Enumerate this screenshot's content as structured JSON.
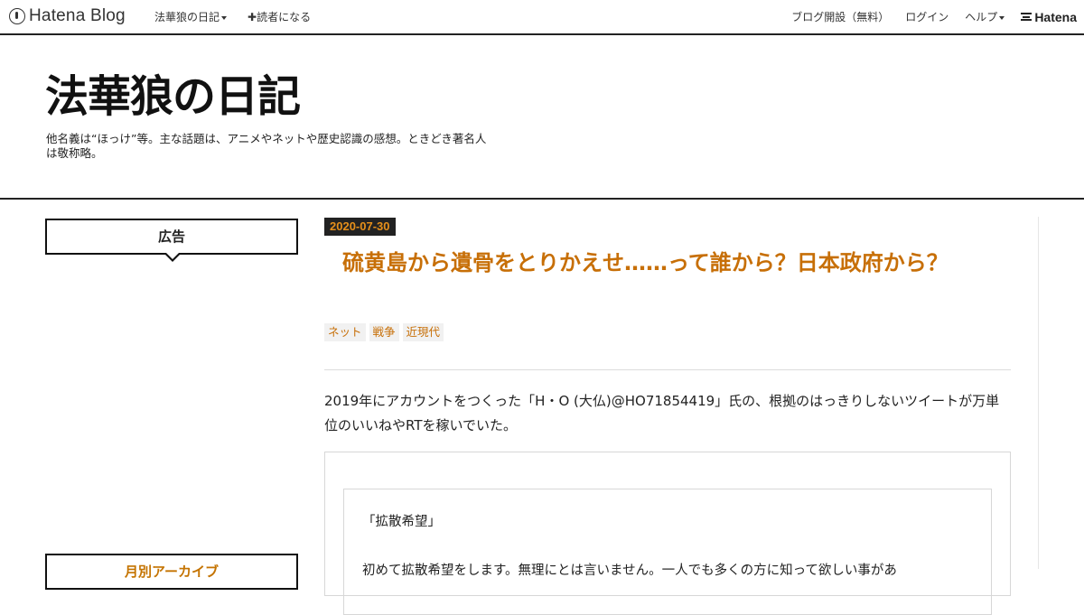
{
  "navbar": {
    "brand": "Hatena Blog",
    "blog_menu": "法華狼の日記",
    "subscribe": "✚読者になる",
    "open_blog": "ブログ開設（無料）",
    "login": "ログイン",
    "help": "ヘルプ",
    "hatena_logo": "Hatena"
  },
  "header": {
    "title": "法華狼の日記",
    "description": "他名義は“ほっけ”等。主な話題は、アニメやネットや歴史認識の感想。ときどき著名人は敬称略。"
  },
  "sidebar": {
    "ad_label": "広告",
    "archive_label": "月別アーカイブ"
  },
  "entry": {
    "date": "2020-07-30",
    "title": "硫黄島から遺骨をとりかえせ……って誰から？日本政府から？",
    "tags": [
      "ネット",
      "戦争",
      "近現代"
    ],
    "body": "2019年にアカウントをつくった「H・O (大仏)@HO71854419」氏の、根拠のはっきりしないツイートが万単位のいいねやRTを稼いでいた。",
    "embed_quote_title": "「拡散希望」",
    "embed_quote_text": "初めて拡散希望をします。無理にとは言いません。一人でも多くの方に知って欲しい事があ"
  },
  "colors": {
    "accent": "#c76f07",
    "date_text": "#e58f1a",
    "border": "#222222"
  }
}
